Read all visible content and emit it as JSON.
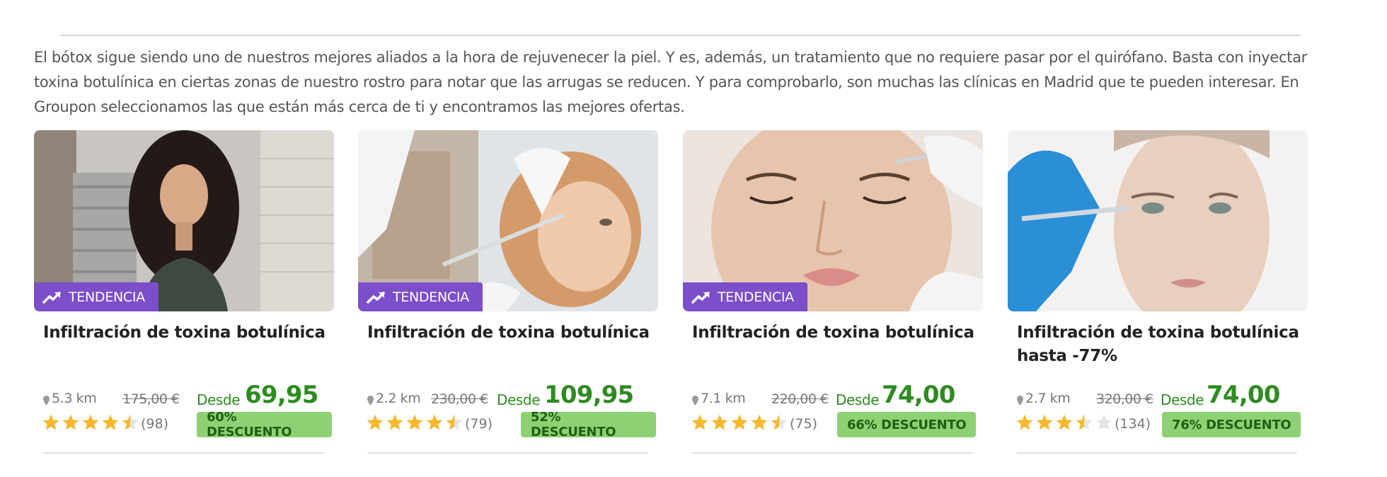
{
  "intro_text": "El bótox sigue siendo uno de nuestros mejores aliados a la hora de rejuvenecer la piel. Y es, además, un tratamiento que no requiere pasar por el quirófano. Basta con inyectar toxina botulínica en ciertas zonas de nuestro rostro para notar que las arrugas se reducen. Y para comprobarlo, son muchas las clínicas en Madrid que te pueden interesar. En Groupon seleccionamos las que están más cerca de ti y encontramos las mejores ofertas.",
  "colors": {
    "accent_purple": "#7b4fc9",
    "price_green": "#2e8b20",
    "discount_bg": "#8ed174",
    "star": "#f5b82e"
  },
  "deals": [
    {
      "badge": "TENDENCIA",
      "title": "Infiltración de toxina botulínica",
      "distance": "5.3 km",
      "old_price": "175,00 €",
      "desde": "Desde",
      "price": "69,95 €",
      "rating": 4.5,
      "reviews": "(98)",
      "discount": "60% DESCUENTO",
      "image": "woman-long-hair-photo"
    },
    {
      "badge": "TENDENCIA",
      "title": "Infiltración de toxina botulínica",
      "distance": "2.2 km",
      "old_price": "230,00 €",
      "desde": "Desde",
      "price": "109,95 €",
      "rating": 4.5,
      "reviews": "(79)",
      "discount": "52% DESCUENTO",
      "image": "forehead-injection-photo"
    },
    {
      "badge": "TENDENCIA",
      "title": "Infiltración de toxina botulínica",
      "distance": "7.1 km",
      "old_price": "220,00 €",
      "desde": "Desde",
      "price": "74,00 €",
      "rating": 4.5,
      "reviews": "(75)",
      "discount": "66% DESCUENTO",
      "image": "face-closed-eyes-photo"
    },
    {
      "badge": "",
      "title": "Infiltración de toxina botulínica hasta -77%",
      "distance": "2.7 km",
      "old_price": "320,00 €",
      "desde": "Desde",
      "price": "74,00 €",
      "rating": 3.5,
      "reviews": "(134)",
      "discount": "76% DESCUENTO",
      "image": "eye-injection-photo"
    }
  ]
}
